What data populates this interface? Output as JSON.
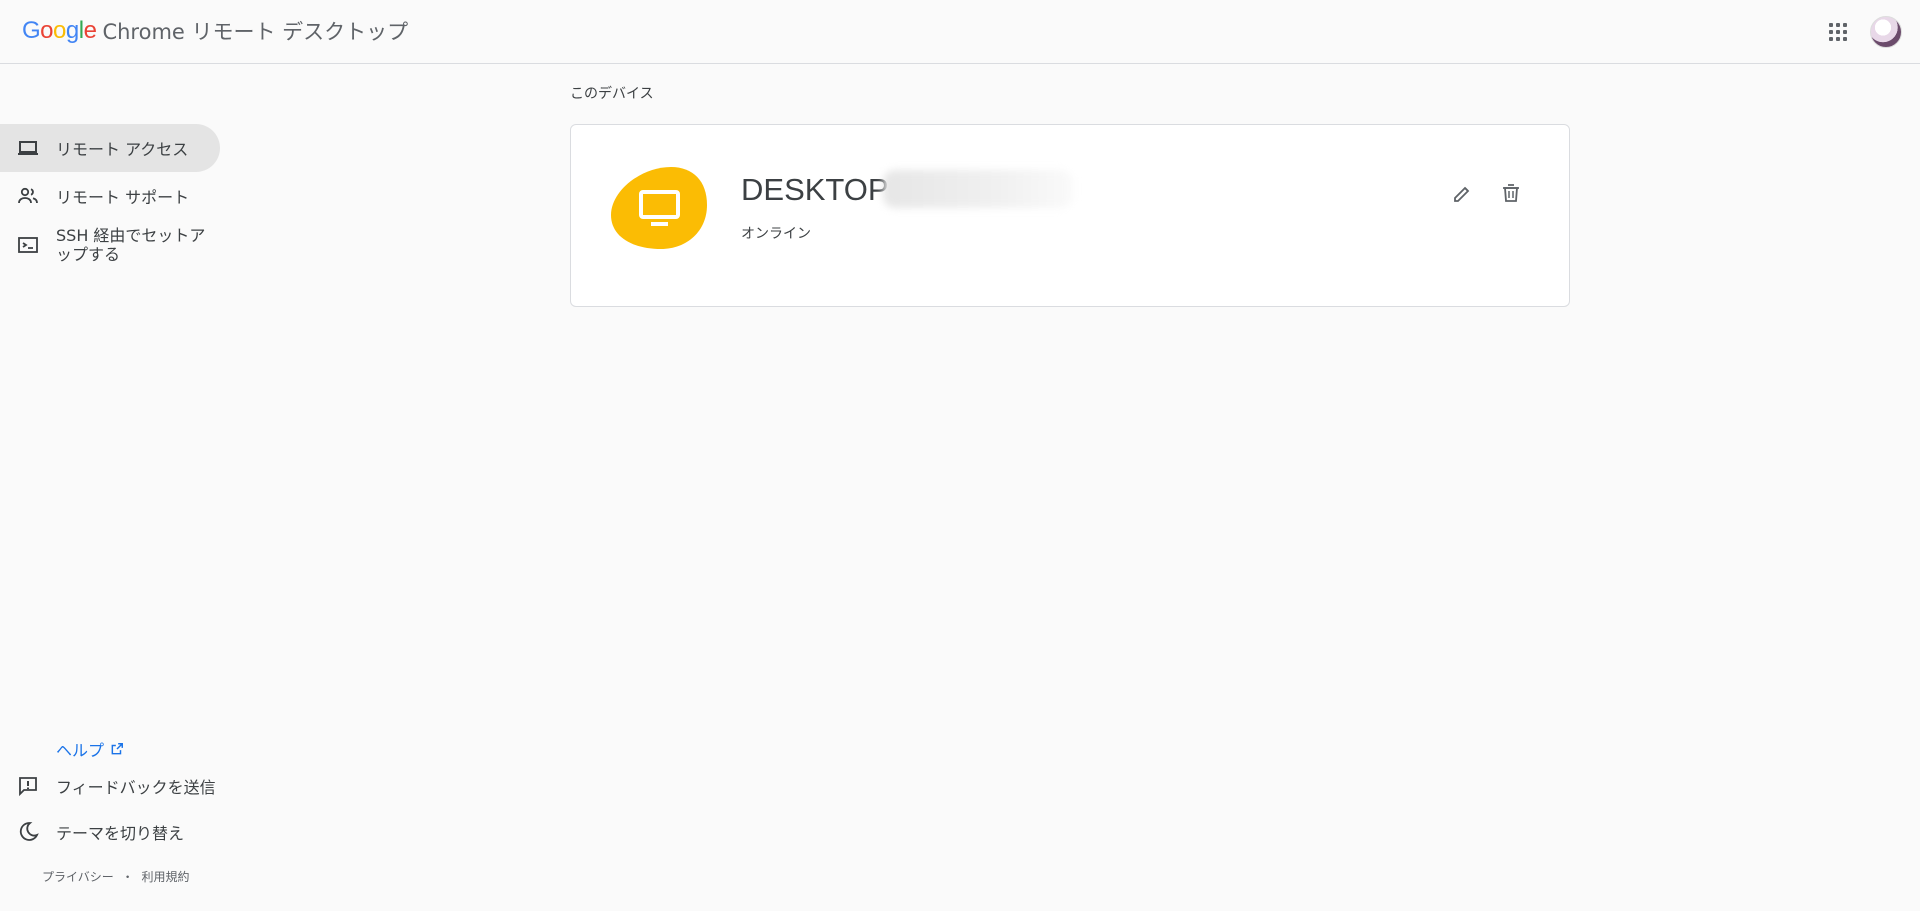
{
  "header": {
    "google_word": "Google",
    "product_name": "Chrome リモート デスクトップ",
    "apps_icon": "apps-grid-icon",
    "avatar_icon": "account-avatar"
  },
  "sidebar": {
    "items": [
      {
        "label": "リモート アクセス",
        "icon": "laptop-icon",
        "active": true
      },
      {
        "label": "リモート サポート",
        "icon": "people-icon",
        "active": false
      },
      {
        "label": "SSH 経由でセットアップする",
        "icon": "terminal-icon",
        "active": false
      }
    ],
    "help_label": "ヘルプ",
    "feedback_label": "フィードバックを送信",
    "theme_label": "テーマを切り替え",
    "privacy_label": "プライバシー",
    "separator": "・",
    "terms_label": "利用規約"
  },
  "main": {
    "section_title": "このデバイス",
    "device": {
      "name": "DESKTOP",
      "status": "オンライン",
      "icon": "monitor-icon"
    }
  },
  "colors": {
    "accent_yellow": "#fbbc04",
    "link_blue": "#1a73e8",
    "active_nav_bg": "#e4e4e4"
  }
}
